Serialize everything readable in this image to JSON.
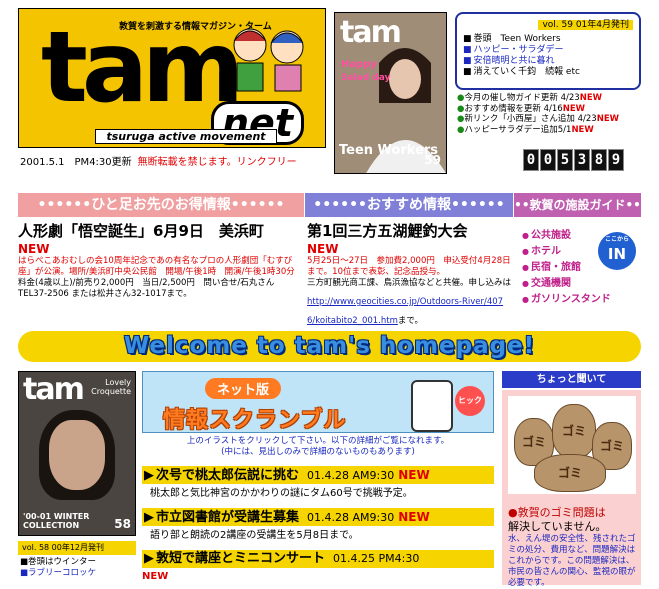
{
  "logo": {
    "tagline": "敦賀を刺激する情報マガジン・ターム",
    "main": "tam",
    "net": "net",
    "sub": "tsuruga active movement"
  },
  "updated": {
    "datetime": "2001.5.1　PM4:30更新",
    "warning": "無断転載を禁じます。リンクフリー"
  },
  "cover": {
    "title": "tam",
    "line1": "Happy",
    "line2": "Salad day",
    "foot": "Teen Workers",
    "number": "59"
  },
  "issue": {
    "header": "vol. 59  01年4月発刊",
    "items": [
      {
        "text": "巻頭　Teen Workers",
        "blue": false
      },
      {
        "text": "ハッピー・サラダデー",
        "blue": true
      },
      {
        "text": "安倍晴明と共に暮れ",
        "blue": true
      },
      {
        "text": "消えていく千鈞　続報 etc",
        "blue": false
      }
    ]
  },
  "news": [
    {
      "text": "今月の催し物ガイド更新 4/23",
      "new": "NEW"
    },
    {
      "text": "おすすめ情報を更新 4/16",
      "new": "NEW"
    },
    {
      "text": "新リンク「小西屋」さん追加 4/23",
      "new": "NEW"
    },
    {
      "text": "ハッピーサラダデー追加5/1",
      "new": "NEW"
    }
  ],
  "counter": [
    "0",
    "0",
    "5",
    "3",
    "8",
    "9"
  ],
  "bars": {
    "left": "••••••ひと足お先のお得情報••••••",
    "mid": "••••••おすすめ情報••••••",
    "right": "••敦賀の施設ガイド••"
  },
  "col1": {
    "title": "人形劇「悟空誕生」6月9日　美浜町",
    "new": "NEW",
    "red": "はらぺこあおむしの会10周年記念であの有名なプロの人形劇団「むすび座」が公演。場所/美浜町中央公民館　開場/午後1時　開演/午後1時30分",
    "body": "料金(4歳以上)/前売り2,000円　当日/2,500円　問い合せ/石丸さんTEL37-2506 または松井さん32-1017まで。"
  },
  "col2": {
    "title": "第1回三方五湖鯉釣大会",
    "new": "NEW",
    "red": "5月25日〜27日　参加費2,000円　申込受付4月28日まで。10位まで表彰、記念品授与。",
    "body": "三方町観光商工課、鳥浜漁協などと共催。申し込みは",
    "link": "http://www.geocities.co.jp/Outdoors-River/4076/koitabito2_001.htm",
    "after": "まで。"
  },
  "guide": {
    "items": [
      "公共施設",
      "ホテル",
      "民宿・旅館",
      "交通機関",
      "ガソリンスタンド"
    ],
    "in_small": "ここから",
    "in_big": "IN"
  },
  "welcome": "Welcome to tam's homepage!",
  "cover2": {
    "title": "tam",
    "sub1": "Lovely",
    "sub2": "Croquette",
    "foot": "'00-01 WINTER COLLECTION",
    "number": "58"
  },
  "issue2": "vol. 58 00年12月発刊",
  "list2": [
    {
      "text": "■巻頭はウインター",
      "blue": false
    },
    {
      "text": "■ラブリーコロッケ",
      "blue": true
    }
  ],
  "scramble": {
    "net": "ネット版",
    "title": "情報スクランブル",
    "hit": "ヒック",
    "note1": "上のイラストをクリックして下さい。以下の詳細がご覧になれます。",
    "note2": "(中には、見出しのみで詳細のないものもあります)"
  },
  "headlines": [
    {
      "title": "次号で桃太郎伝説に挑む",
      "date": "01.4.28 AM9:30",
      "new": "NEW",
      "body": "桃太郎と気比神宮のかかわりの謎にタム60号で挑戦予定。"
    },
    {
      "title": "市立図書館が受講生募集",
      "date": "01.4.28 AM9:30",
      "new": "NEW",
      "body": "語り部と朗読の2講座の受講生を5月8日まで。"
    },
    {
      "title": "敦短で講座とミニコンサート",
      "date": "01.4.25 PM4:30",
      "new": "",
      "body": "NEW"
    }
  ],
  "ask": {
    "header": "ちょっと聞いて",
    "bag": "ゴミ",
    "title1": "●敦賀のゴミ問題は",
    "title2": "解決していません。",
    "text": "水、えん堤の安全性、残されたゴミの処分、費用など、問題解決はこれからです。この問題解決は、市民の皆さんの関心、監視の眼が必要です。"
  }
}
